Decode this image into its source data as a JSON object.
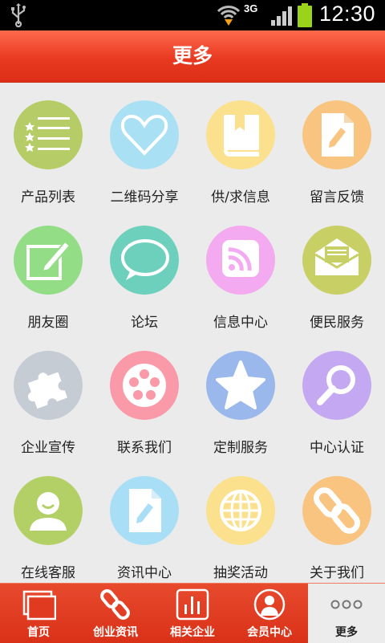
{
  "status_bar": {
    "network": "3G",
    "time": "12:30"
  },
  "header": {
    "title": "更多"
  },
  "grid": [
    {
      "label": "产品列表",
      "icon": "list-icon",
      "color": "#b6cc66"
    },
    {
      "label": "二维码分享",
      "icon": "heart-icon",
      "color": "#a9e0f4"
    },
    {
      "label": "供/求信息",
      "icon": "book-icon",
      "color": "#fbe08e"
    },
    {
      "label": "留言反馈",
      "icon": "edit-document-icon",
      "color": "#f9c47f"
    },
    {
      "label": "朋友圈",
      "icon": "pencil-square-icon",
      "color": "#93dd86"
    },
    {
      "label": "论坛",
      "icon": "chat-bubble-icon",
      "color": "#6dd0bd"
    },
    {
      "label": "信息中心",
      "icon": "rss-icon",
      "color": "#f3aaf0"
    },
    {
      "label": "便民服务",
      "icon": "envelope-icon",
      "color": "#c8cf64"
    },
    {
      "label": "企业宣传",
      "icon": "puzzle-icon",
      "color": "#c6ccd4"
    },
    {
      "label": "联系我们",
      "icon": "film-reel-icon",
      "color": "#fa99a7"
    },
    {
      "label": "定制服务",
      "icon": "star-icon",
      "color": "#9ab8ec"
    },
    {
      "label": "中心认证",
      "icon": "magnifier-icon",
      "color": "#c4a9f2"
    },
    {
      "label": "在线客服",
      "icon": "user-icon",
      "color": "#b3d067"
    },
    {
      "label": "资讯中心",
      "icon": "edit-document-icon",
      "color": "#a9dff6"
    },
    {
      "label": "抽奖活动",
      "icon": "globe-icon",
      "color": "#fbe08e"
    },
    {
      "label": "关于我们",
      "icon": "link-chain-icon",
      "color": "#f9c47f"
    }
  ],
  "tabbar": [
    {
      "label": "首页",
      "icon": "pages-icon",
      "active": false
    },
    {
      "label": "创业资讯",
      "icon": "link-chain-icon",
      "active": false
    },
    {
      "label": "相关企业",
      "icon": "bar-chart-icon",
      "active": false
    },
    {
      "label": "会员中心",
      "icon": "person-icon",
      "active": false
    },
    {
      "label": "更多",
      "icon": "more-dots-icon",
      "active": true
    }
  ],
  "colors": {
    "header_red": "#e83a21",
    "tab_red": "#d93118",
    "background": "#ebebeb"
  }
}
